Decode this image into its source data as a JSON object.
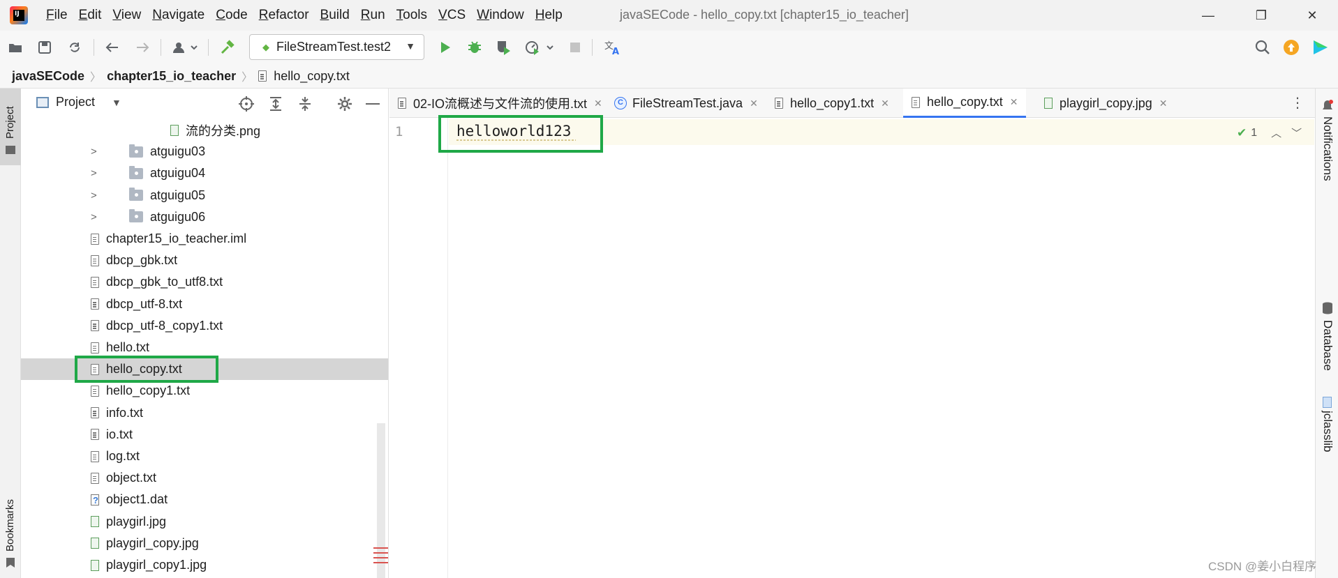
{
  "menu": [
    "File",
    "Edit",
    "View",
    "Navigate",
    "Code",
    "Refactor",
    "Build",
    "Run",
    "Tools",
    "VCS",
    "Window",
    "Help"
  ],
  "window_title": "javaSECode - hello_copy.txt [chapter15_io_teacher]",
  "window_controls": {
    "minimize": "—",
    "restore": "❐",
    "close": "✕"
  },
  "toolbar": {
    "run_config": "FileStreamTest.test2",
    "icons": [
      "open-folder-icon",
      "save-icon",
      "sync-icon",
      "back-icon",
      "forward-icon",
      "user-icon",
      "build-icon",
      "run-icon",
      "debug-icon",
      "coverage-icon",
      "profile-icon",
      "stop-icon",
      "translate-icon",
      "search-icon",
      "update-icon",
      "plugin-icon"
    ]
  },
  "breadcrumb": [
    "javaSECode",
    "chapter15_io_teacher",
    "hello_copy.txt"
  ],
  "left_strip": {
    "project": "Project",
    "bookmarks": "Bookmarks"
  },
  "project_panel": {
    "title": "Project",
    "tree": [
      {
        "label": "流的分类.png",
        "type": "image",
        "indent": 2,
        "expandable": false
      },
      {
        "label": "atguigu03",
        "type": "folder",
        "indent": 1,
        "expandable": true
      },
      {
        "label": "atguigu04",
        "type": "folder",
        "indent": 1,
        "expandable": true
      },
      {
        "label": "atguigu05",
        "type": "folder",
        "indent": 1,
        "expandable": true
      },
      {
        "label": "atguigu06",
        "type": "folder",
        "indent": 1,
        "expandable": true
      },
      {
        "label": "chapter15_io_teacher.iml",
        "type": "file",
        "indent": 0,
        "expandable": false
      },
      {
        "label": "dbcp_gbk.txt",
        "type": "file",
        "indent": 0,
        "expandable": false
      },
      {
        "label": "dbcp_gbk_to_utf8.txt",
        "type": "file",
        "indent": 0,
        "expandable": false
      },
      {
        "label": "dbcp_utf-8.txt",
        "type": "file",
        "indent": 0,
        "expandable": false
      },
      {
        "label": "dbcp_utf-8_copy1.txt",
        "type": "file",
        "indent": 0,
        "expandable": false
      },
      {
        "label": "hello.txt",
        "type": "file",
        "indent": 0,
        "expandable": false
      },
      {
        "label": "hello_copy.txt",
        "type": "file",
        "indent": 0,
        "expandable": false,
        "selected": true
      },
      {
        "label": "hello_copy1.txt",
        "type": "file",
        "indent": 0,
        "expandable": false
      },
      {
        "label": "info.txt",
        "type": "file",
        "indent": 0,
        "expandable": false
      },
      {
        "label": "io.txt",
        "type": "file",
        "indent": 0,
        "expandable": false
      },
      {
        "label": "log.txt",
        "type": "file",
        "indent": 0,
        "expandable": false
      },
      {
        "label": "object.txt",
        "type": "file",
        "indent": 0,
        "expandable": false
      },
      {
        "label": "object1.dat",
        "type": "unknown",
        "indent": 0,
        "expandable": false
      },
      {
        "label": "playgirl.jpg",
        "type": "image",
        "indent": 0,
        "expandable": false
      },
      {
        "label": "playgirl_copy.jpg",
        "type": "image",
        "indent": 0,
        "expandable": false
      },
      {
        "label": "playgirl_copy1.jpg",
        "type": "image",
        "indent": 0,
        "expandable": false
      }
    ]
  },
  "editor_tabs": [
    {
      "label": "02-IO流概述与文件流的使用.txt",
      "type": "text",
      "active": false
    },
    {
      "label": "FileStreamTest.java",
      "type": "java",
      "active": false
    },
    {
      "label": "hello_copy1.txt",
      "type": "text",
      "active": false
    },
    {
      "label": "hello_copy.txt",
      "type": "text",
      "active": true
    },
    {
      "label": "playgirl_copy.jpg",
      "type": "image",
      "active": false
    }
  ],
  "editor": {
    "line_number": "1",
    "content": "helloworld123",
    "inspection_count": "1"
  },
  "right_strip": [
    "Notifications",
    "Database",
    "jclasslib"
  ],
  "watermark": "CSDN @姜小白程序",
  "colors": {
    "highlight": "#1fa847",
    "accent": "#3574f0",
    "run": "#4caf50",
    "selection": "#d5d5d5"
  }
}
